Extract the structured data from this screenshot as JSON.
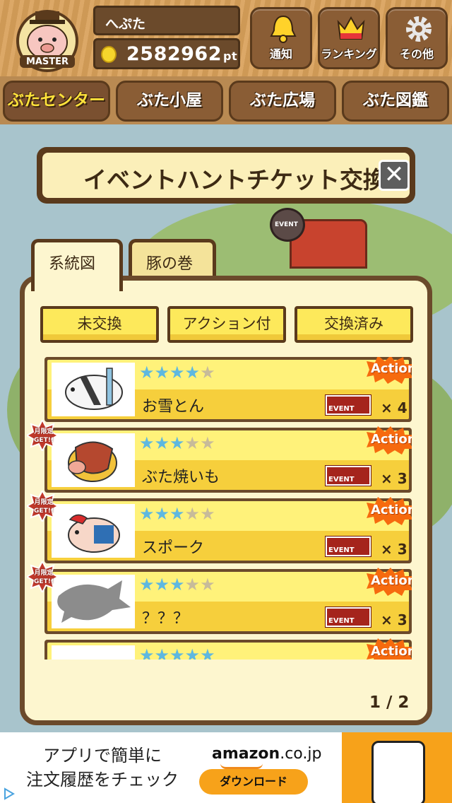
{
  "header": {
    "user_name": "へぷた",
    "points_value": "2582962",
    "points_unit": "pt",
    "avatar_badge": "MASTER",
    "buttons": [
      {
        "label": "通知",
        "icon": "bell-icon"
      },
      {
        "label": "ランキング",
        "icon": "crown-icon"
      },
      {
        "label": "その他",
        "icon": "gear-icon"
      }
    ]
  },
  "tabs": [
    {
      "label": "ぶたセンター",
      "active": true
    },
    {
      "label": "ぶた小屋",
      "active": false
    },
    {
      "label": "ぶた広場",
      "active": false
    },
    {
      "label": "ぶた図鑑",
      "active": false
    }
  ],
  "scenery": {
    "sign_text": "EVENT"
  },
  "dialog": {
    "title": "イベントハントチケット交換所",
    "close_label": "✕"
  },
  "panel_tabs": [
    {
      "label": "系統図",
      "active": true
    },
    {
      "label": "豚の巻",
      "active": false
    }
  ],
  "filters": [
    {
      "label": "未交換"
    },
    {
      "label": "アクション付"
    },
    {
      "label": "交換済み"
    }
  ],
  "items": [
    {
      "name": "お雪とん",
      "stars": 4,
      "max_stars": 5,
      "count": "× 4",
      "badge": "Action",
      "event": "EVENT",
      "limited": false
    },
    {
      "name": "ぶた焼いも",
      "stars": 3,
      "max_stars": 5,
      "count": "× 3",
      "badge": "Action",
      "event": "EVENT",
      "limited": true,
      "limited_text": [
        "月限定",
        "GET!!"
      ]
    },
    {
      "name": "スポーク",
      "stars": 3,
      "max_stars": 5,
      "count": "× 3",
      "badge": "Action",
      "event": "EVENT",
      "limited": true,
      "limited_text": [
        "月限定",
        "GET!!"
      ]
    },
    {
      "name": "？？？",
      "stars": 3,
      "max_stars": 5,
      "count": "× 3",
      "badge": "Action",
      "event": "EVENT",
      "limited": true,
      "limited_text": [
        "月限定",
        "GET!!"
      ]
    },
    {
      "name": "",
      "stars": 5,
      "max_stars": 5,
      "count": "",
      "badge": "Action",
      "event": "",
      "limited": false
    }
  ],
  "pagination": "1 / 2",
  "ad": {
    "text_line1": "アプリで簡単に",
    "text_line2": "注文履歴をチェック",
    "brand": "amazon",
    "brand_tld": ".co.jp",
    "button": "ダウンロード"
  },
  "colors": {
    "wood": "#d9a15a",
    "dark_wood": "#6b4a2b",
    "panel_bg": "#fdf6cf",
    "yellow": "#fde95b",
    "star_on": "#5eb8e0",
    "action_orange": "#f66a0e",
    "ad_orange": "#f7a21a"
  }
}
